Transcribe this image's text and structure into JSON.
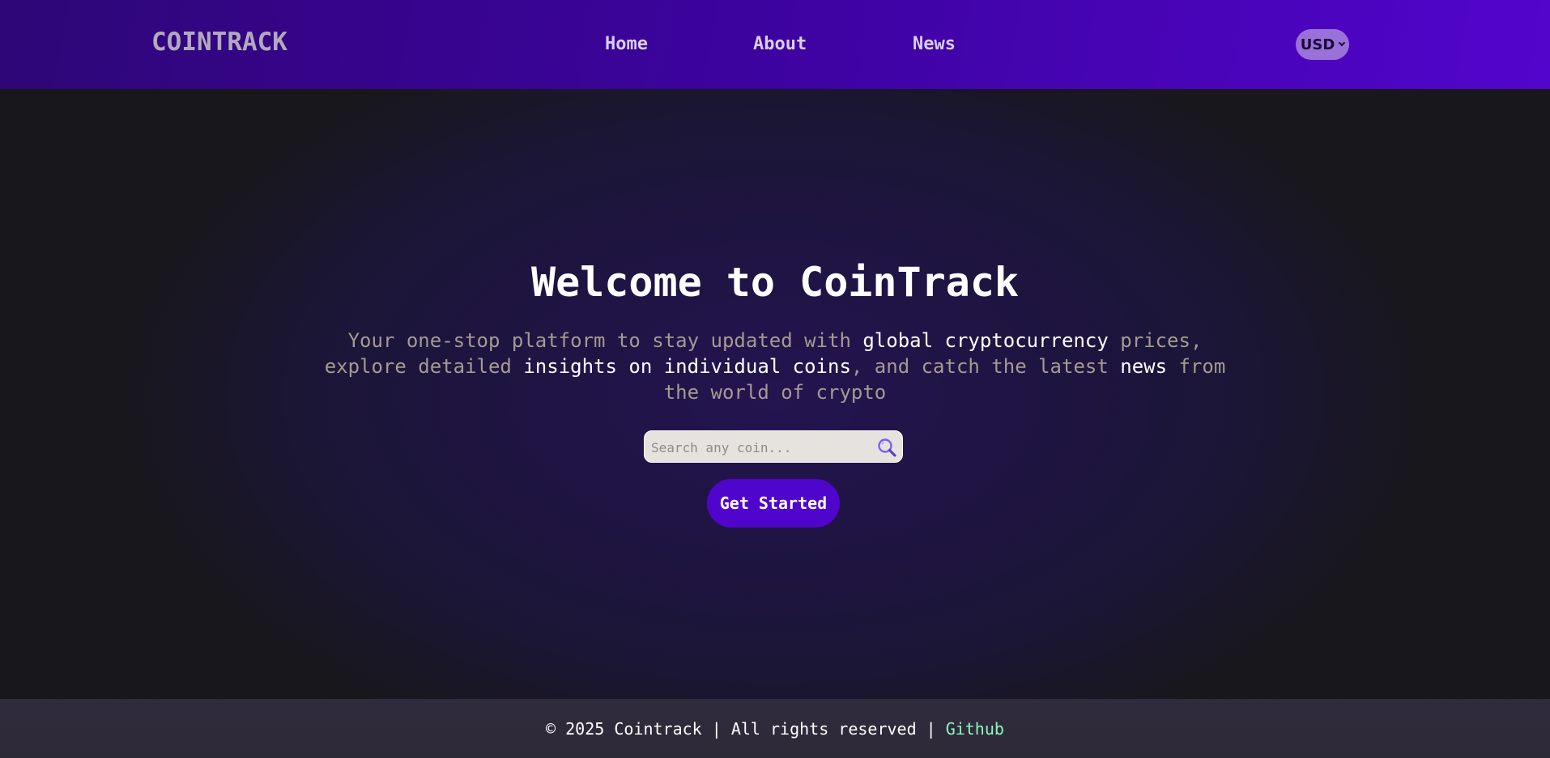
{
  "header": {
    "logo": "COINTRACK",
    "nav": [
      {
        "label": "Home"
      },
      {
        "label": "About"
      },
      {
        "label": "News"
      }
    ],
    "currency": {
      "selected": "USD"
    }
  },
  "hero": {
    "title": "Welcome to CoinTrack",
    "description": {
      "part1": "Your one-stop platform to stay updated with ",
      "highlight1": "global cryptocurrency",
      "part2": " prices, explore detailed ",
      "highlight2": "insights on individual coins",
      "part3": ", and catch the latest ",
      "highlight3": "news",
      "part4": " from the world of crypto"
    },
    "search": {
      "placeholder": "Search any coin...",
      "value": ""
    },
    "cta_label": "Get Started"
  },
  "footer": {
    "text": "© 2025 Cointrack | All rights reserved |",
    "link_label": "Github"
  },
  "colors": {
    "header_gradient_start": "#2e0677",
    "header_gradient_end": "#5205cc",
    "accent": "#5005cc",
    "footer_link": "#8ff5c0",
    "search_icon": "#7a5bff"
  }
}
